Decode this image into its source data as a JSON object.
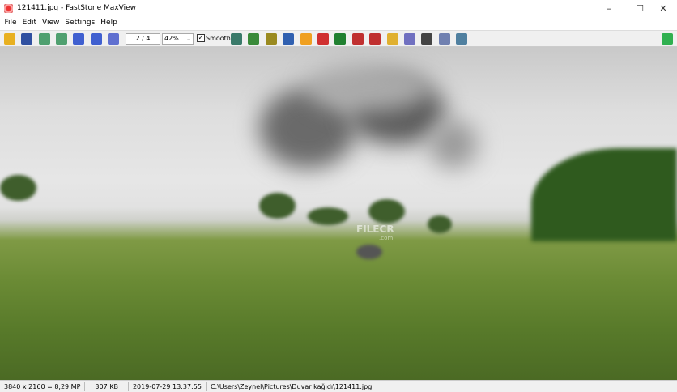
{
  "window": {
    "title": "121411.jpg - FastStone MaxView",
    "minimize": "–",
    "maximize": "☐",
    "close": "✕"
  },
  "menu": [
    "File",
    "Edit",
    "View",
    "Settings",
    "Help"
  ],
  "toolbar": {
    "page": "2 / 4",
    "zoom": "42%",
    "smooth_label": "Smooth",
    "smooth_checked": true,
    "left_icons": [
      "open-icon",
      "save-icon",
      "previous-icon",
      "next-icon",
      "zoom-in-icon",
      "zoom-out-icon",
      "actual-size-icon"
    ],
    "right_icons": [
      "slideshow-icon",
      "crop-icon",
      "resize-icon",
      "color-icon",
      "adjust-lighting-icon",
      "effects-icon",
      "sharpen-icon",
      "rotate-left-icon",
      "rotate-right-icon",
      "folder-icon",
      "print-icon",
      "capture-icon",
      "scan-icon",
      "properties-icon"
    ],
    "fullscreen_icon": "fullscreen-icon"
  },
  "watermark": {
    "text": "FILECR",
    "sub": ".com"
  },
  "status": {
    "dimensions": "3840 x 2160 = 8,29 MP",
    "size": "307 KB",
    "date": "2019-07-29 13:37:55",
    "path": "C:\\Users\\Zeynel\\Pictures\\Duvar kağıdı\\121411.jpg"
  }
}
